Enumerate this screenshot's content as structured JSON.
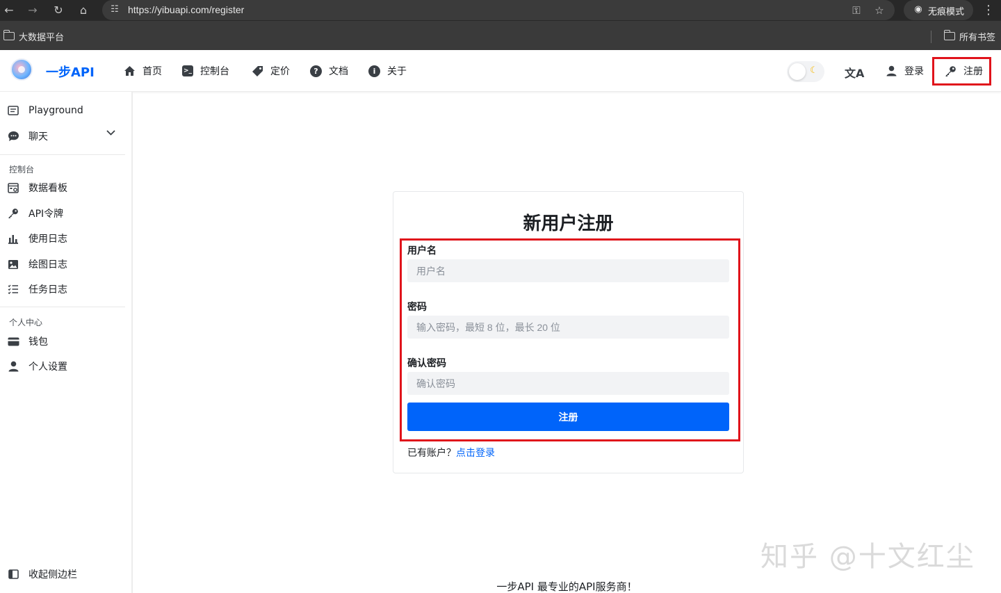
{
  "browser": {
    "url": "https://yibuapi.com/register",
    "incognito_label": "无痕模式",
    "bookmark_left": "大数据平台",
    "bookmark_right": "所有书签"
  },
  "header": {
    "brand": "一步API",
    "nav": [
      {
        "label": "首页",
        "icon": "home-icon"
      },
      {
        "label": "控制台",
        "icon": "console-icon"
      },
      {
        "label": "定价",
        "icon": "tag-icon"
      },
      {
        "label": "文档",
        "icon": "help-icon"
      },
      {
        "label": "关于",
        "icon": "info-icon"
      }
    ],
    "login_label": "登录",
    "register_label": "注册"
  },
  "sidebar": {
    "items": [
      {
        "label": "Playground",
        "icon": "playground-icon"
      },
      {
        "label": "聊天",
        "icon": "chat-icon"
      }
    ],
    "section_console": "控制台",
    "console_items": [
      {
        "label": "数据看板",
        "icon": "dashboard-icon"
      },
      {
        "label": "API令牌",
        "icon": "key-icon"
      },
      {
        "label": "使用日志",
        "icon": "bar-chart-icon"
      },
      {
        "label": "绘图日志",
        "icon": "image-icon"
      },
      {
        "label": "任务日志",
        "icon": "task-list-icon"
      }
    ],
    "section_personal": "个人中心",
    "personal_items": [
      {
        "label": "钱包",
        "icon": "wallet-icon"
      },
      {
        "label": "个人设置",
        "icon": "user-icon"
      }
    ],
    "collapse_label": "收起侧边栏"
  },
  "form": {
    "title": "新用户注册",
    "username_label": "用户名",
    "username_placeholder": "用户名",
    "password_label": "密码",
    "password_placeholder": "输入密码，最短 8 位，最长 20 位",
    "confirm_label": "确认密码",
    "confirm_placeholder": "确认密码",
    "submit_label": "注册",
    "has_account_text": "已有账户？",
    "login_link": "点击登录"
  },
  "watermark": "知乎 @十文红尘",
  "footer": "一步API 最专业的API服务商！",
  "colors": {
    "accent": "#0064fa",
    "highlight": "#e0131b"
  }
}
